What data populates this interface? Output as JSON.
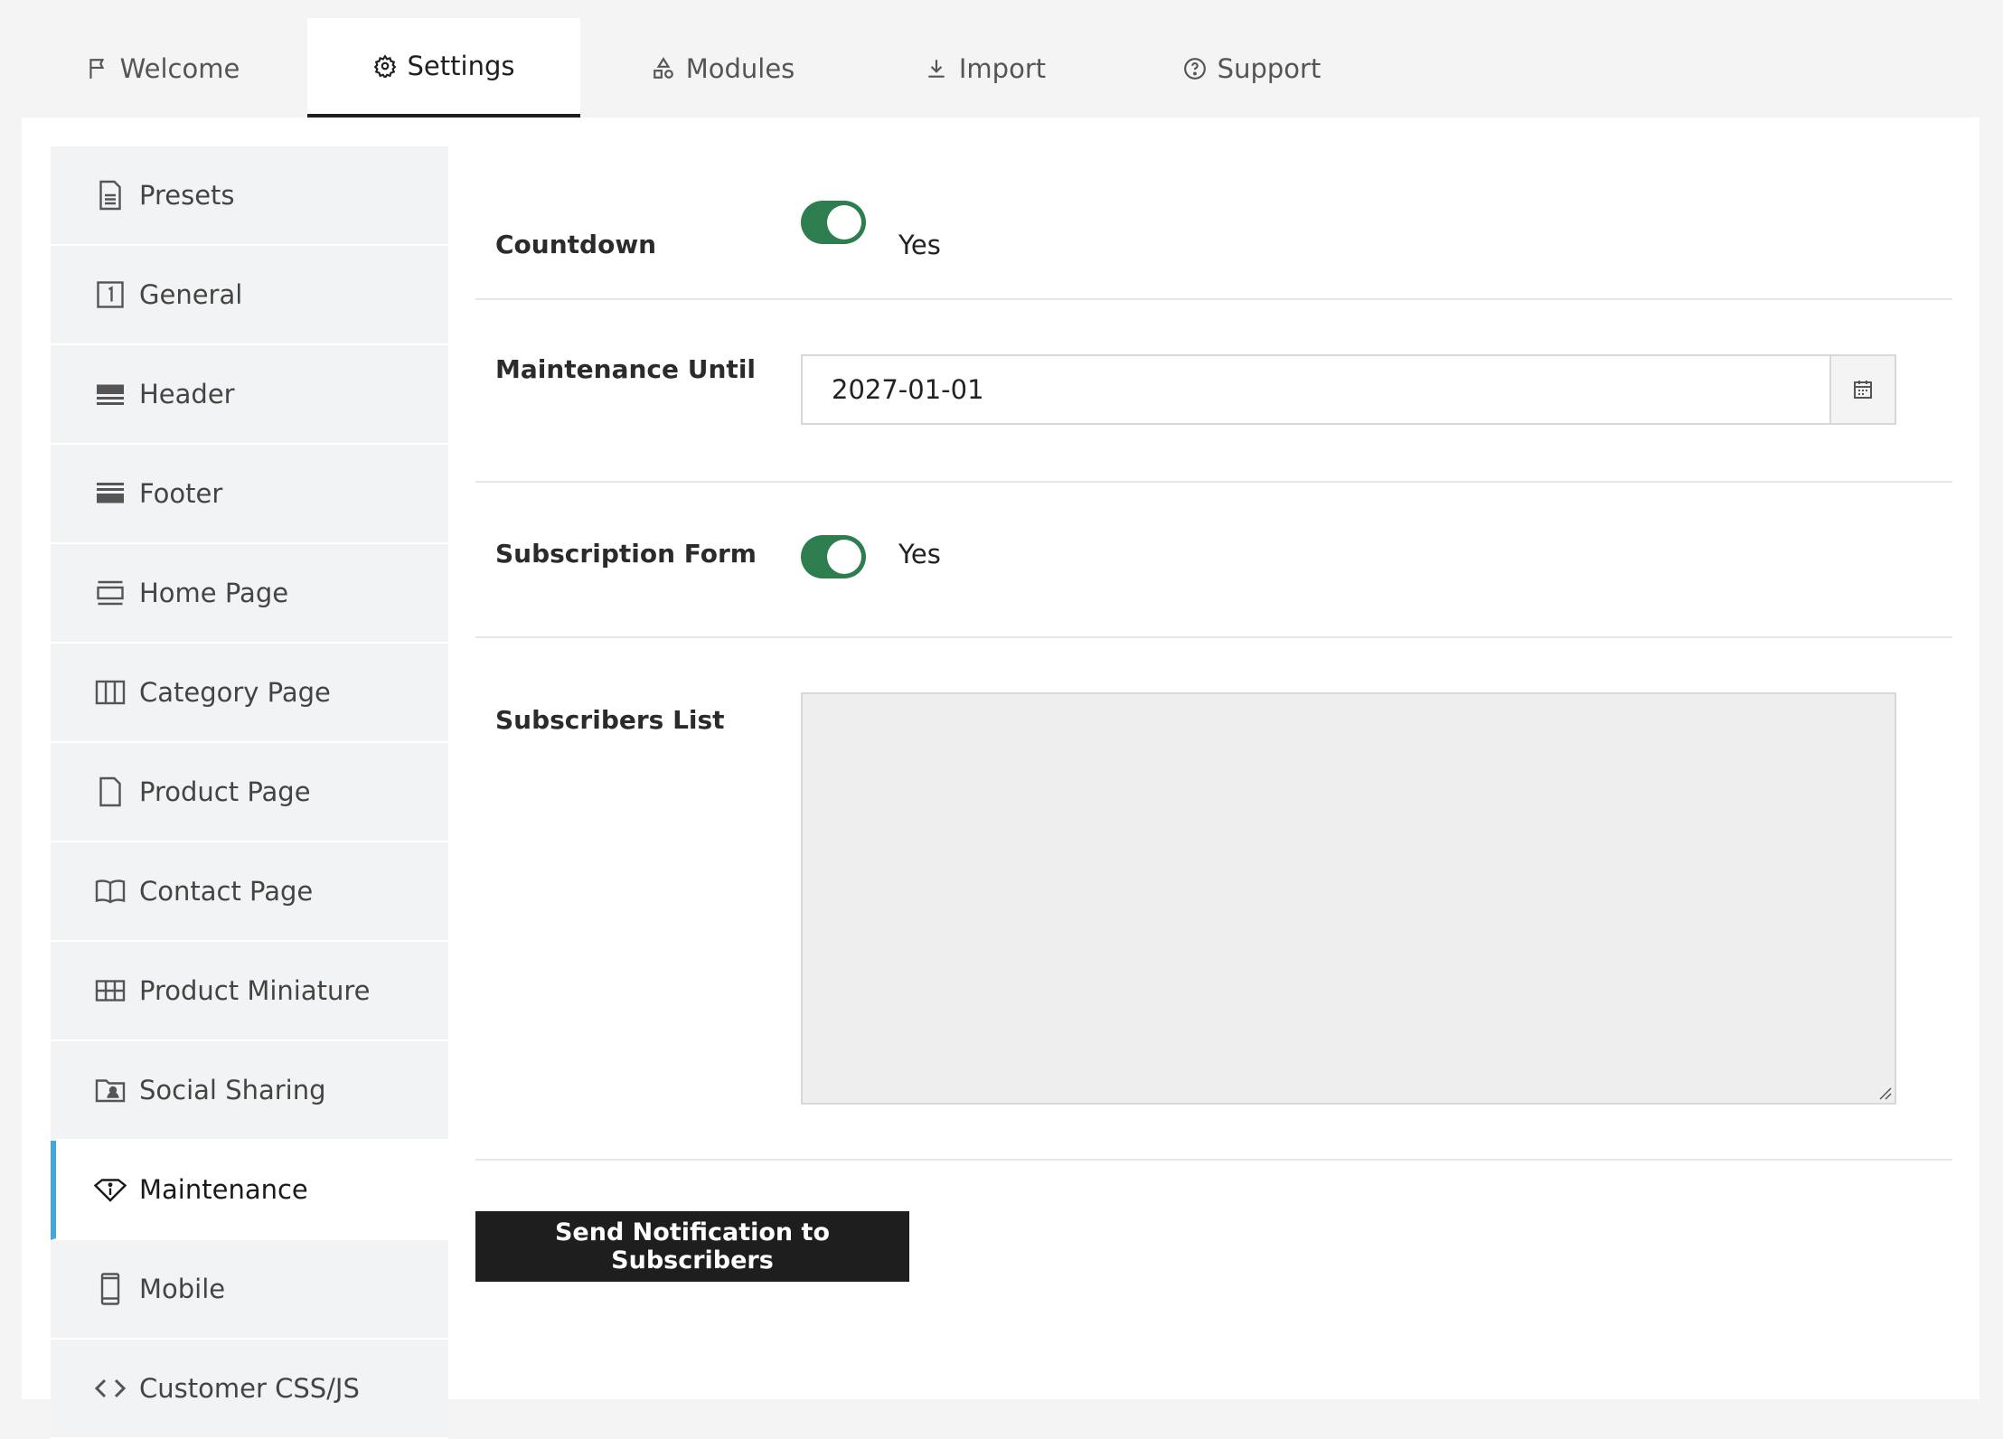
{
  "tabs": [
    {
      "label": "Welcome",
      "icon": "flag-icon"
    },
    {
      "label": "Settings",
      "icon": "gear-icon"
    },
    {
      "label": "Modules",
      "icon": "shapes-icon"
    },
    {
      "label": "Import",
      "icon": "download-icon"
    },
    {
      "label": "Support",
      "icon": "help-circle-icon"
    }
  ],
  "sidebar": {
    "items": [
      {
        "label": "Presets",
        "icon": "document-icon"
      },
      {
        "label": "General",
        "icon": "number-one-icon"
      },
      {
        "label": "Header",
        "icon": "header-icon"
      },
      {
        "label": "Footer",
        "icon": "footer-icon"
      },
      {
        "label": "Home Page",
        "icon": "home-page-icon"
      },
      {
        "label": "Category Page",
        "icon": "columns-icon"
      },
      {
        "label": "Product Page",
        "icon": "page-icon"
      },
      {
        "label": "Contact Page",
        "icon": "book-icon"
      },
      {
        "label": "Product Miniature",
        "icon": "grid-icon"
      },
      {
        "label": "Social Sharing",
        "icon": "folder-user-icon"
      },
      {
        "label": "Maintenance",
        "icon": "diamond-info-icon"
      },
      {
        "label": "Mobile",
        "icon": "mobile-icon"
      },
      {
        "label": "Customer CSS/JS",
        "icon": "code-icon"
      }
    ],
    "active": "Maintenance",
    "active_color": "#46a6d6"
  },
  "form": {
    "countdown": {
      "label": "Countdown",
      "value": "Yes"
    },
    "maintenance_until": {
      "label": "Maintenance Until",
      "value": "2027-01-01"
    },
    "subscription_form": {
      "label": "Subscription Form",
      "value": "Yes"
    },
    "subscribers_list": {
      "label": "Subscribers List",
      "value": ""
    },
    "send_button": "Send Notification to Subscribers"
  },
  "colors": {
    "toggle_on": "#2e7d4f",
    "button_dark": "#1e1e1e"
  }
}
